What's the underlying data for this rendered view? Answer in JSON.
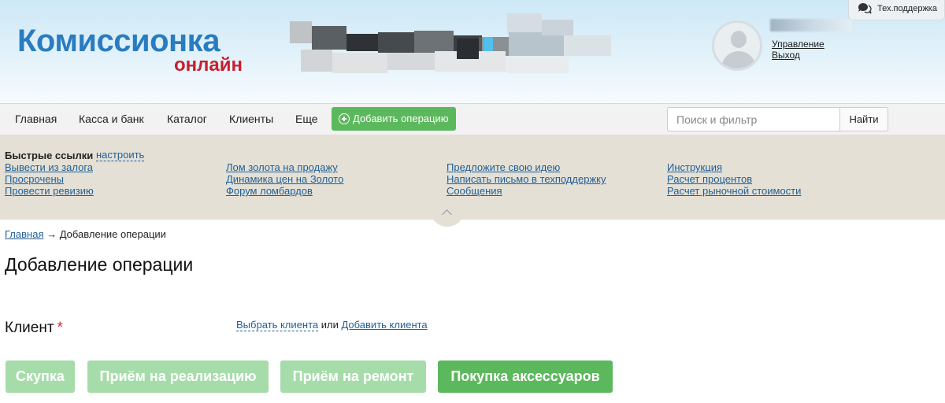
{
  "header": {
    "logo_main": "Комиссионка",
    "logo_sub": "онлайн",
    "user_links": [
      "Управление",
      "Выход"
    ],
    "support_label": "Тех.поддержка"
  },
  "nav": {
    "items": [
      "Главная",
      "Касса и банк",
      "Каталог",
      "Клиенты",
      "Еще"
    ],
    "add_operation": "Добавить операцию",
    "search": {
      "placeholder": "Поиск и фильтр",
      "value": ""
    },
    "search_button": "Найти"
  },
  "quick_links": {
    "title": "Быстрые ссылки",
    "configure": "настроить",
    "columns": [
      [
        "Вывести из залога",
        "Просрочены",
        "Провести ревизию"
      ],
      [
        "Лом золота на продажу",
        "Динамика цен на Золото",
        "Форум ломбардов"
      ],
      [
        "Предложите свою идею",
        "Написать письмо в техподдержку",
        "Сообщения"
      ],
      [
        "Инструкция",
        "Расчет процентов",
        "Расчет рыночной стоимости"
      ]
    ]
  },
  "breadcrumb": {
    "home": "Главная",
    "arrow": "→",
    "current": "Добавление операции"
  },
  "page_title": "Добавление операции",
  "client": {
    "label": "Клиент",
    "required_mark": "*",
    "select": "Выбрать клиента",
    "or": "или",
    "add": "Добавить клиента"
  },
  "operation_buttons": [
    "Скупка",
    "Приём на реализацию",
    "Приём на ремонт",
    "Покупка аксессуаров"
  ],
  "colors": {
    "logo_blue": "#2a7cc0",
    "logo_red": "#c8202f",
    "green": "#5cb85c",
    "green_disabled": "#a6dcaa",
    "link": "#1f5f97",
    "quick_bg": "#e4e0d6"
  }
}
